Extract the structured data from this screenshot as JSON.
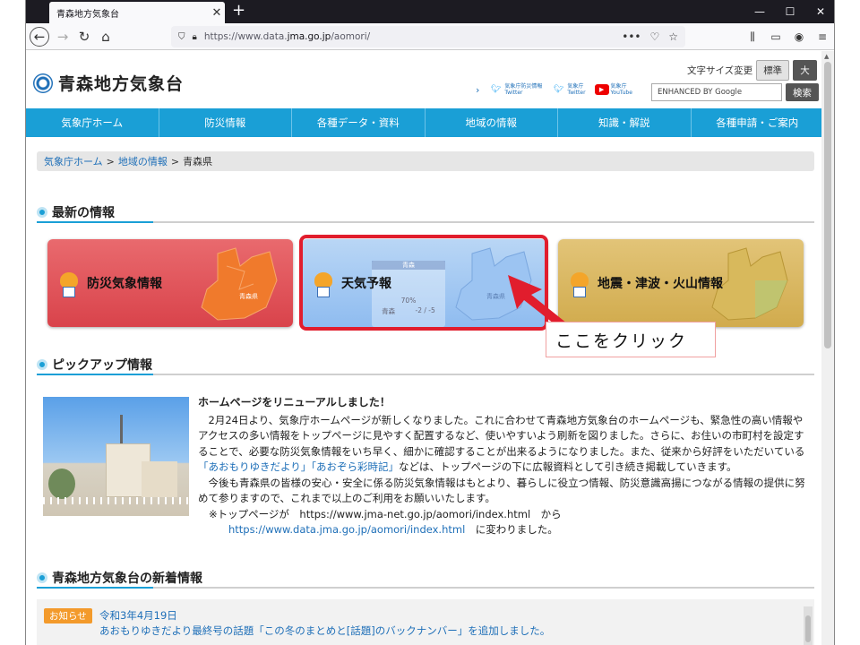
{
  "browser": {
    "tab_title": "青森地方気象台",
    "tab_close": "✕",
    "new_tab": "+",
    "window_controls": [
      "—",
      "☐",
      "✕"
    ],
    "url_prefix": "https://www.data.",
    "url_domain": "jma.go.jp",
    "url_path": "/aomori/",
    "url_actions": [
      "•••",
      "♡",
      "☆"
    ]
  },
  "site": {
    "name": "青森地方気象台",
    "font_size_label": "文字サイズ変更",
    "font_std": "標準",
    "font_large": "大",
    "social": [
      {
        "label_line1": "気象庁防災情報",
        "label_line2": "Twitter",
        "icon": "twitter-icon"
      },
      {
        "label_line1": "気象庁",
        "label_line2": "Twitter",
        "icon": "twitter-icon"
      },
      {
        "label_line1": "気象庁",
        "label_line2": "YouTube",
        "icon": "youtube-icon"
      }
    ],
    "search_placeholder": "ENHANCED BY Google",
    "search_button": "検索"
  },
  "nav": [
    "気象庁ホーム",
    "防災情報",
    "各種データ・資料",
    "地域の情報",
    "知識・解説",
    "各種申請・ご案内"
  ],
  "breadcrumb": {
    "home": "気象庁ホーム",
    "sep": ">",
    "region": "地域の情報",
    "current": "青森県"
  },
  "latest": {
    "heading": "最新の情報",
    "banners": [
      "防災気象情報",
      "天気予報",
      "地震・津波・火山情報"
    ],
    "forecast_panel": {
      "header": "青森",
      "pct": "70%",
      "city": "青森",
      "temps": "-2 / -5"
    },
    "map_label": "青森県",
    "callout": "ここをクリック"
  },
  "pickup": {
    "heading": "ピックアップ情報",
    "title": "ホームページをリニューアルしました！",
    "p1": "2月24日より、気象庁ホームページが新しくなりました。これに合わせて青森地方気象台のホームページも、緊急性の高い情報やアクセスの多い情報をトップページに見やすく配置するなど、使いやすいよう刷新を図りました。さらに、お住いの市町村を設定することで、必要な防災気象情報をいち早く、細かに確認することが出来るようになりました。また、従来から好評をいただいている",
    "link1": "「あおもりゆきだより」",
    "link2": "「あおぞら彩時記」",
    "p1_end": "などは、トップページの下に広報資料として引き続き掲載していきます。",
    "p2": "今後も青森県の皆様の安心・安全に係る防災気象情報はもとより、暮らしに役立つ情報、防災意識高揚につながる情報の提供に努めて参りますので、これまで以上のご利用をお願いいたします。",
    "note1": "※トップページが　https://www.jma-net.go.jp/aomori/index.html　から",
    "note2_link": "https://www.data.jma.go.jp/aomori/index.html",
    "note2_end": "　に変わりました。"
  },
  "news": {
    "heading": "青森地方気象台の新着情報",
    "badge": "お知らせ",
    "date": "令和3年4月19日",
    "text": "あおもりゆきだより最終号の話題「この冬のまとめと[話題]のバックナンバー」を追加しました。"
  },
  "colors": {
    "accent": "#1a9fd6",
    "highlight": "#e11d2d",
    "badge": "#f39a2b",
    "link": "#1e6fb8"
  }
}
